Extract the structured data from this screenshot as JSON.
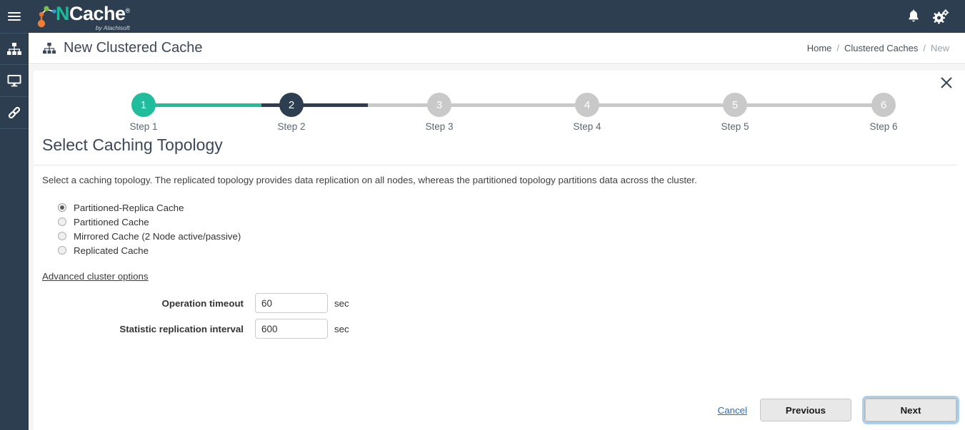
{
  "topbar": {
    "menu_icon": "hamburger-icon",
    "logo": {
      "name_prefix": "N",
      "name_rest": "Cache",
      "registered_mark": "®",
      "subtitle": "by Alachisoft"
    },
    "notifications_icon": "bell-icon",
    "settings_icon": "gears-icon"
  },
  "sidebar": {
    "items": [
      {
        "icon": "cluster-sitemap-icon",
        "name": "clustered-caches"
      },
      {
        "icon": "monitor-icon",
        "name": "monitoring"
      },
      {
        "icon": "link-chain-icon",
        "name": "bridges"
      }
    ]
  },
  "pagehead": {
    "icon": "cluster-sitemap-icon",
    "title": "New Clustered Cache",
    "breadcrumb": {
      "home": "Home",
      "sep1": "/",
      "clustered_caches": "Clustered Caches",
      "sep2": "/",
      "current": "New"
    }
  },
  "close_icon": "close-x-icon",
  "stepper": {
    "steps": [
      {
        "number": "1",
        "label": "Step 1",
        "state": "done"
      },
      {
        "number": "2",
        "label": "Step 2",
        "state": "current"
      },
      {
        "number": "3",
        "label": "Step 3",
        "state": "todo"
      },
      {
        "number": "4",
        "label": "Step 4",
        "state": "todo"
      },
      {
        "number": "5",
        "label": "Step 5",
        "state": "todo"
      },
      {
        "number": "6",
        "label": "Step 6",
        "state": "todo"
      }
    ],
    "colors": {
      "done": "#1fbd9c",
      "current": "#2c3e50",
      "todo": "#c9c9c9"
    }
  },
  "main": {
    "section_title": "Select Caching Topology",
    "description": "Select a caching topology. The replicated topology provides data replication on all nodes, whereas the partitioned topology partitions data across the cluster.",
    "topology_options": [
      {
        "label": "Partitioned-Replica Cache",
        "selected": true
      },
      {
        "label": "Partitioned Cache",
        "selected": false
      },
      {
        "label": "Mirrored Cache (2 Node active/passive)",
        "selected": false
      },
      {
        "label": "Replicated Cache",
        "selected": false
      }
    ],
    "advanced_link": "Advanced cluster options",
    "fields": [
      {
        "label": "Operation timeout",
        "value": "60",
        "unit": "sec"
      },
      {
        "label": "Statistic replication interval",
        "value": "600",
        "unit": "sec"
      }
    ]
  },
  "footer": {
    "cancel": "Cancel",
    "previous": "Previous",
    "next": "Next"
  }
}
